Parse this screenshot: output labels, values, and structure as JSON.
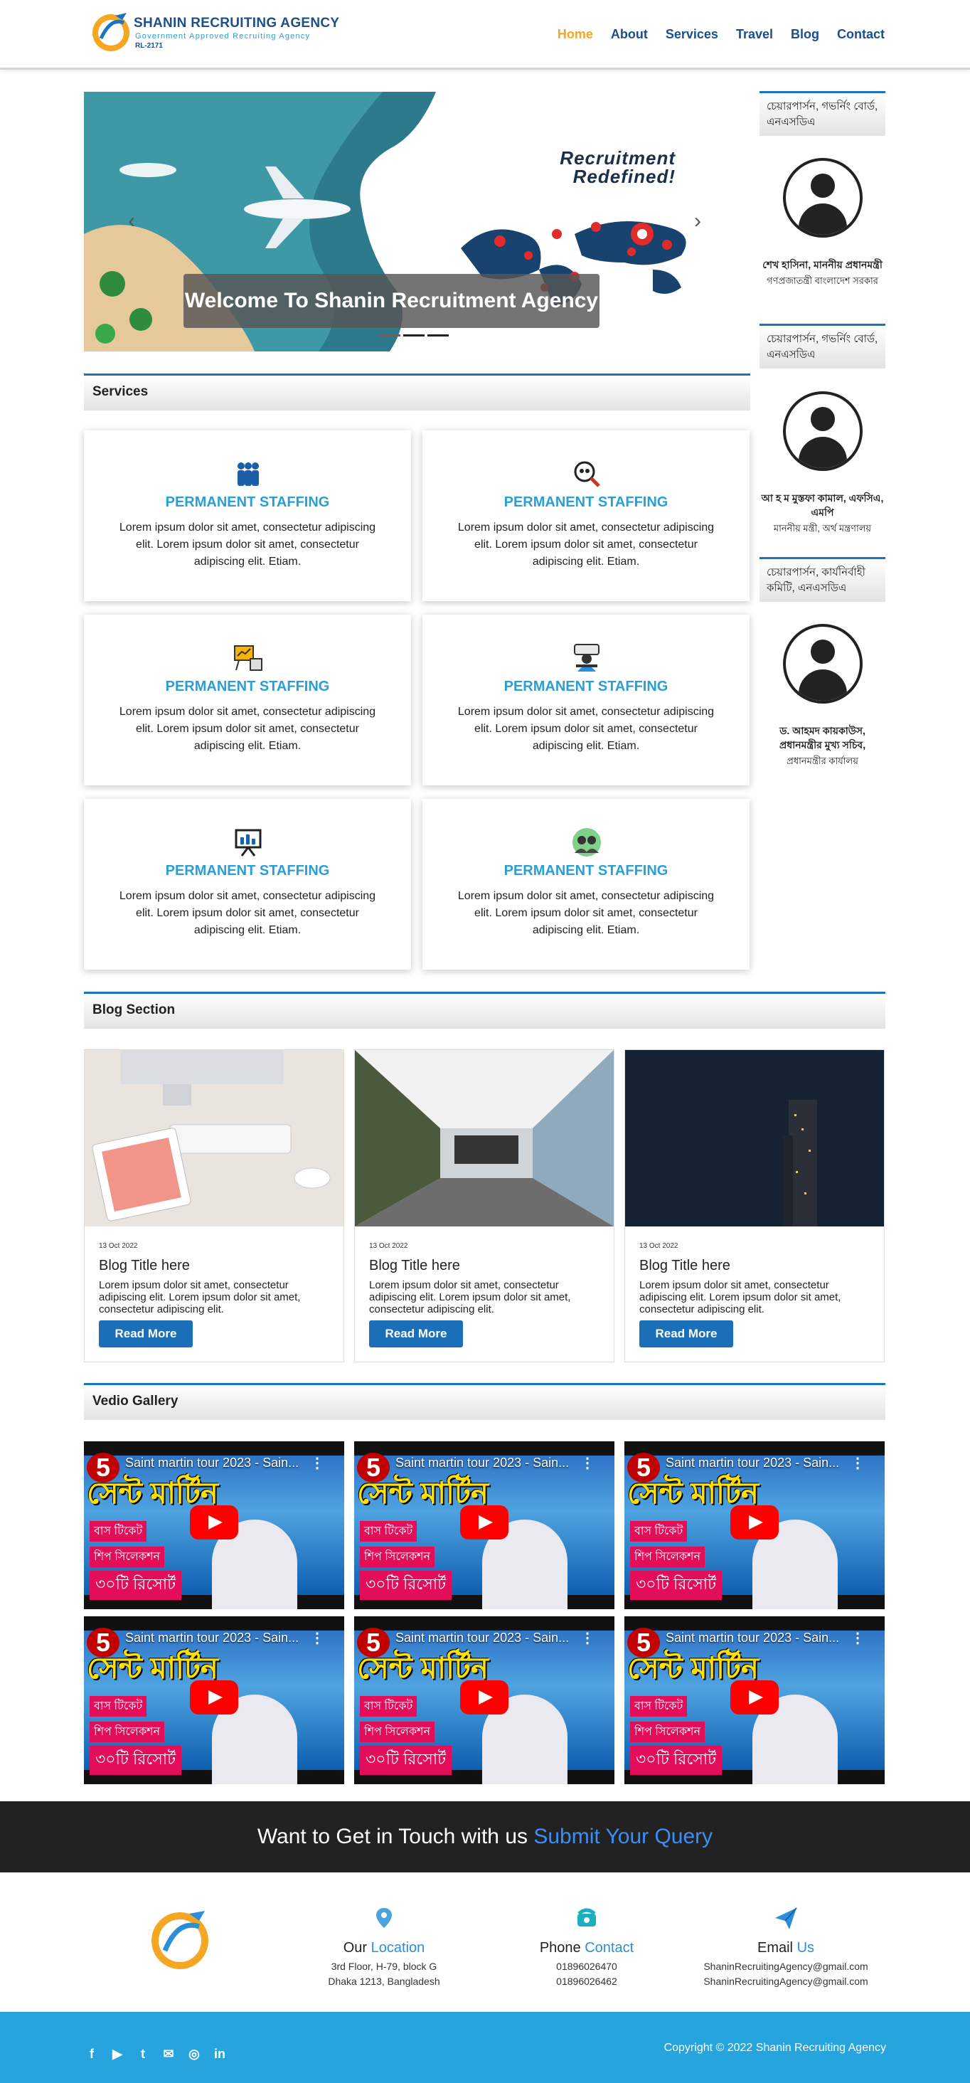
{
  "brand": {
    "name": "SHANIN RECRUITING AGENCY",
    "tagline": "Government Approved Recruiting Agency",
    "license": "RL-2171"
  },
  "nav": [
    {
      "label": "Home",
      "active": true
    },
    {
      "label": "About",
      "active": false
    },
    {
      "label": "Services",
      "active": false
    },
    {
      "label": "Travel",
      "active": false
    },
    {
      "label": "Blog",
      "active": false
    },
    {
      "label": "Contact",
      "active": false
    }
  ],
  "slider": {
    "banner_line1": "Recruitment",
    "banner_line2": "Redefined!",
    "caption": "Welcome To Shanin Recruitment Agency",
    "prev": "‹",
    "next": "›"
  },
  "sections": {
    "services": "Services",
    "blog": "Blog Section",
    "video": "Vedio Gallery"
  },
  "services": [
    {
      "icon": "team-icon",
      "title": "PERMANENT STAFFING",
      "text": "Lorem ipsum dolor sit amet, consectetur adipiscing elit. Lorem ipsum dolor sit amet, consectetur adipiscing elit. Etiam."
    },
    {
      "icon": "search-people-icon",
      "title": "PERMANENT STAFFING",
      "text": "Lorem ipsum dolor sit amet, consectetur adipiscing elit. Lorem ipsum dolor sit amet, consectetur adipiscing elit. Etiam."
    },
    {
      "icon": "presentation-icon",
      "title": "PERMANENT STAFFING",
      "text": "Lorem ipsum dolor sit amet, consectetur adipiscing elit. Lorem ipsum dolor sit amet, consectetur adipiscing elit. Etiam."
    },
    {
      "icon": "support-agent-icon",
      "title": "PERMANENT STAFFING",
      "text": "Lorem ipsum dolor sit amet, consectetur adipiscing elit. Lorem ipsum dolor sit amet, consectetur adipiscing elit. Etiam."
    },
    {
      "icon": "board-chart-icon",
      "title": "PERMANENT STAFFING",
      "text": "Lorem ipsum dolor sit amet, consectetur adipiscing elit. Lorem ipsum dolor sit amet, consectetur adipiscing elit. Etiam."
    },
    {
      "icon": "group-icon",
      "title": "PERMANENT STAFFING",
      "text": "Lorem ipsum dolor sit amet, consectetur adipiscing elit. Lorem ipsum dolor sit amet, consectetur adipiscing elit. Etiam."
    }
  ],
  "sidebar": [
    {
      "heading": "চেয়ারপার্সন, গভর্নিং বোর্ড, এনএসডিএ",
      "name": "শেখ হাসিনা, মাননীয় প্রধানমন্ত্রী",
      "role": "গণপ্রজাতন্ত্রী বাংলাদেশ সরকার"
    },
    {
      "heading": "চেয়ারপার্সন, গভর্নিং বোর্ড, এনএসডিএ",
      "name": "আ হ ম মুস্তফা কামাল, এফসিএ, এমপি",
      "role": "মাননীয় মন্ত্রী, অর্থ মন্ত্রণালয়"
    },
    {
      "heading": "চেয়ারপার্সন, কার্যনির্বাহী কমিটি, এনএসডিএ",
      "name": "ড. আহমদ কায়কাউস, প্রধানমন্ত্রীর মুখ্য সচিব,",
      "role": "প্রধানমন্ত্রীর কার্যালয়"
    }
  ],
  "blog": [
    {
      "date": "13 Oct 2022",
      "title": "Blog Title here",
      "text": "Lorem ipsum dolor sit amet, consectetur adipiscing elit. Lorem ipsum dolor sit amet, consectetur adipiscing elit.",
      "button": "Read More"
    },
    {
      "date": "13 Oct 2022",
      "title": "Blog Title here",
      "text": "Lorem ipsum dolor sit amet, consectetur adipiscing elit. Lorem ipsum dolor sit amet, consectetur adipiscing elit.",
      "button": "Read More"
    },
    {
      "date": "13 Oct 2022",
      "title": "Blog Title here",
      "text": "Lorem ipsum dolor sit amet, consectetur adipiscing elit. Lorem ipsum dolor sit amet, consectetur adipiscing elit.",
      "button": "Read More"
    }
  ],
  "videos": {
    "title": "Saint martin tour 2023 - Sain...",
    "headline": "সেন্ট মার্টিন",
    "tag1": "বাস টিকেট",
    "tag2": "শিপ সিলেকশন",
    "tag3": "৩০টি রিসোর্ট",
    "count": 6
  },
  "cta": {
    "text": "Want to Get in Touch with us ",
    "link": "Submit Your Query"
  },
  "contact": {
    "location": {
      "label1": "Our ",
      "label2": "Location",
      "line1": "3rd Floor, H-79, block G",
      "line2": "Dhaka 1213, Bangladesh"
    },
    "phone": {
      "label1": "Phone ",
      "label2": "Contact",
      "line1": "01896026470",
      "line2": "01896026462"
    },
    "email": {
      "label1": "Email ",
      "label2": "Us",
      "line1": "ShaninRecruitingAgency@gmail.com",
      "line2": "ShaninRecruitingAgency@gmail.com"
    }
  },
  "footer": {
    "copyright": "Copyright © 2022 Shanin Recruiting Agency",
    "social": [
      "f",
      "▶",
      "t",
      "✉",
      "◎",
      "in"
    ]
  }
}
